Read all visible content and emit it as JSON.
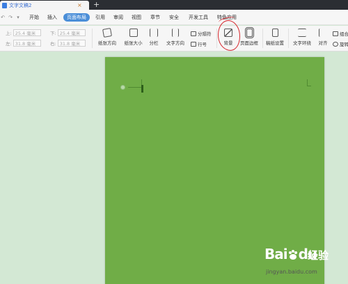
{
  "titlebar": {
    "doc_tab_title": "文字文稿2",
    "close_glyph": "×",
    "new_tab_glyph": "+"
  },
  "menubar": {
    "quick_icons": [
      "↶",
      "↷",
      "▾"
    ],
    "items": [
      {
        "label": "开始",
        "active": false
      },
      {
        "label": "插入",
        "active": false
      },
      {
        "label": "页面布局",
        "active": true
      },
      {
        "label": "引用",
        "active": false
      },
      {
        "label": "审阅",
        "active": false
      },
      {
        "label": "视图",
        "active": false
      },
      {
        "label": "章节",
        "active": false
      },
      {
        "label": "安全",
        "active": false
      },
      {
        "label": "开发工具",
        "active": false
      },
      {
        "label": "特色应用",
        "active": false
      }
    ],
    "active_color": "#4a8ed8"
  },
  "ribbon": {
    "margins": {
      "top": {
        "label": "上:",
        "value": "25.4 毫米"
      },
      "bottom": {
        "label": "下:",
        "value": "25.4 毫米"
      },
      "left": {
        "label": "左:",
        "value": "31.8 毫米"
      },
      "right": {
        "label": "右:",
        "value": "31.8 毫米"
      }
    },
    "buttons": {
      "orientation": "纸张方向",
      "size": "纸张大小",
      "columns": "分栏",
      "text_direction": "文字方向",
      "separator": "分隔符",
      "line_number": "行号",
      "background": "背景",
      "page_border": "页面边框",
      "paper_setup": "稿纸设置",
      "text_wrap": "文字环绕",
      "align": "对齐",
      "group_partial_1": "组合",
      "group_partial_2": "旋转"
    },
    "annotation_color": "#d6252b"
  },
  "document": {
    "page_background": "#70ad47",
    "workspace_background": "#d3e8d4"
  },
  "watermark": {
    "logo": "Bai",
    "logo_suffix": "du",
    "jingyan": "经验",
    "url": "jingyan.baidu.com"
  }
}
